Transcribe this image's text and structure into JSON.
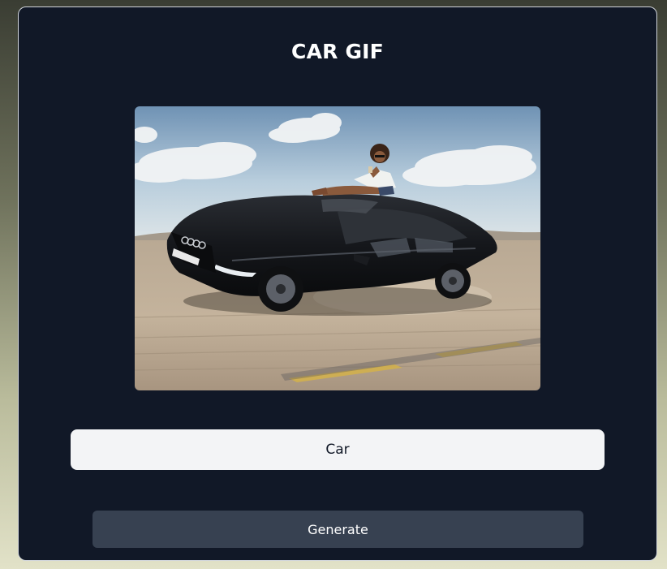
{
  "card": {
    "title": "CAR GIF"
  },
  "preview": {
    "alt": "Black car drifting with person sitting on roof"
  },
  "prompt_input": {
    "value": "Car"
  },
  "generate_button": {
    "label": "Generate"
  },
  "colors": {
    "card_bg": "#111827",
    "input_bg": "#f3f4f6",
    "button_bg": "#374151",
    "title_text": "#ffffff"
  }
}
